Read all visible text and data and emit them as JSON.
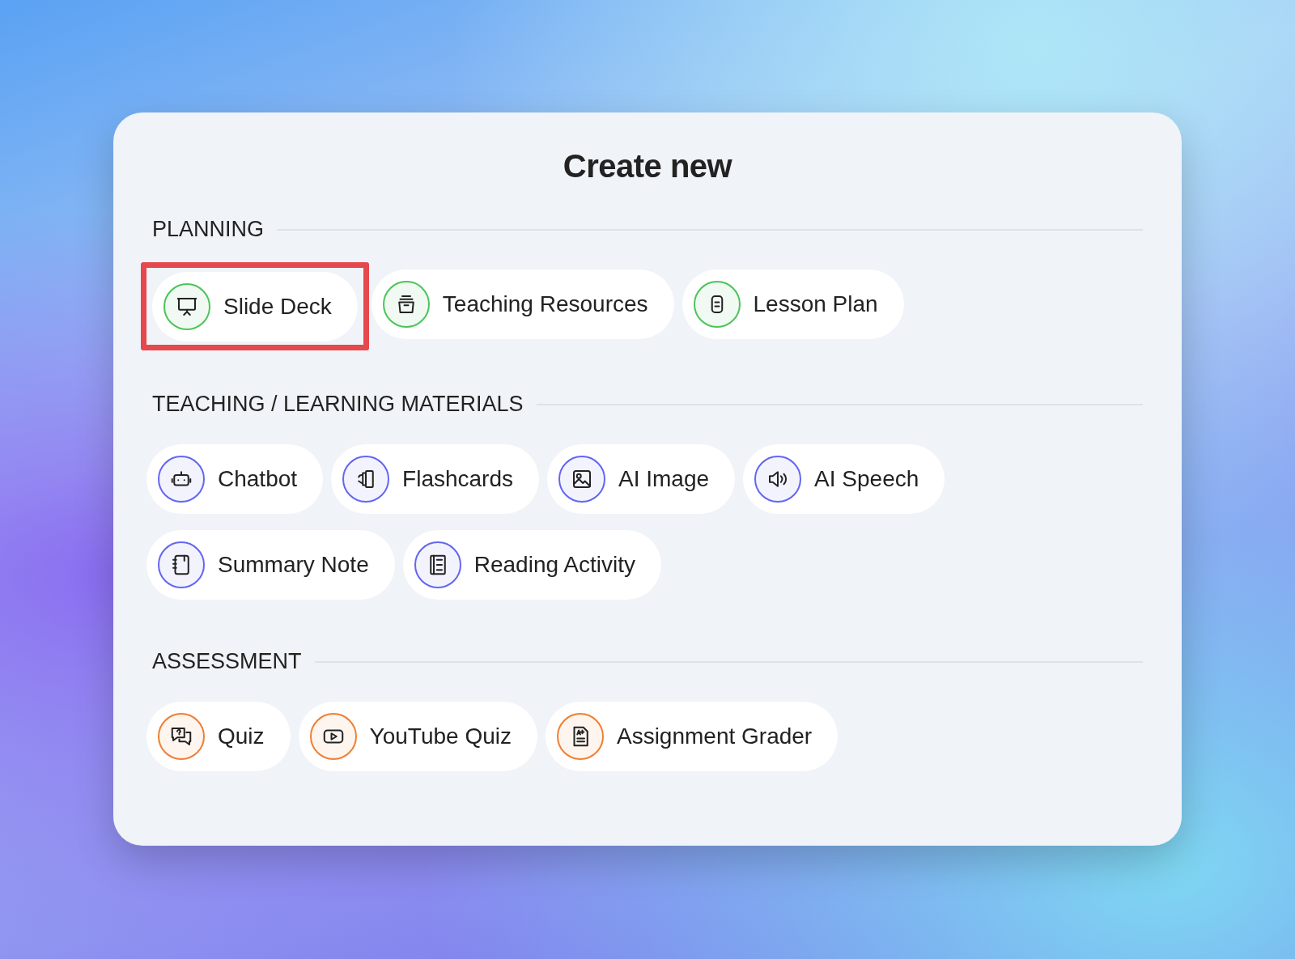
{
  "dialog": {
    "title": "Create new"
  },
  "sections": [
    {
      "label": "PLANNING",
      "color": "#4cc45a",
      "items": [
        {
          "label": "Slide Deck",
          "highlighted": true
        },
        {
          "label": "Teaching Resources",
          "highlighted": false
        },
        {
          "label": "Lesson Plan",
          "highlighted": false
        }
      ]
    },
    {
      "label": "TEACHING / LEARNING MATERIALS",
      "color": "#6466f1",
      "items": [
        {
          "label": "Chatbot",
          "highlighted": false
        },
        {
          "label": "Flashcards",
          "highlighted": false
        },
        {
          "label": "AI Image",
          "highlighted": false
        },
        {
          "label": "AI Speech",
          "highlighted": false
        },
        {
          "label": "Summary Note",
          "highlighted": false
        },
        {
          "label": "Reading Activity",
          "highlighted": false
        }
      ]
    },
    {
      "label": "ASSESSMENT",
      "color": "#f07f32",
      "items": [
        {
          "label": "Quiz",
          "highlighted": false
        },
        {
          "label": "YouTube Quiz",
          "highlighted": false
        },
        {
          "label": "Assignment Grader",
          "highlighted": false
        }
      ]
    }
  ]
}
